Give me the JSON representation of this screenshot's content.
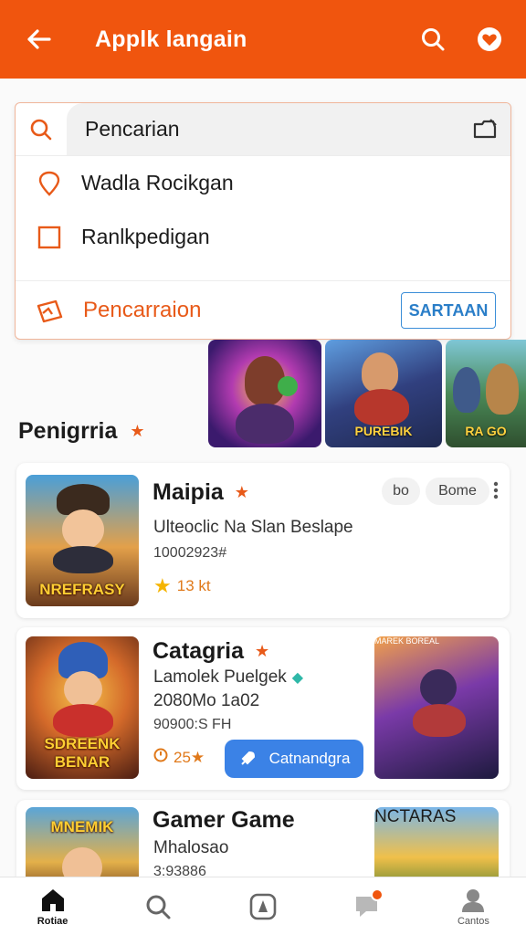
{
  "colors": {
    "accent": "#f0550e",
    "blue": "#3b82e6",
    "star": "#e85a19"
  },
  "header": {
    "title": "Applk langain"
  },
  "search": {
    "placeholder": "Pencarian",
    "options": [
      {
        "label": "Wadla Rocikgan",
        "icon": "location-pin-icon"
      },
      {
        "label": "Ranlkpedigan",
        "icon": "checkbox-icon"
      }
    ],
    "bottom_label": "Pencarraion",
    "bottom_button": "SARTAAN"
  },
  "featured": {
    "title": "Penigrria",
    "items": [
      {
        "label": ""
      },
      {
        "label": "PUREBIK"
      },
      {
        "label": "RA GO"
      }
    ]
  },
  "cards": [
    {
      "title": "Maipia",
      "thumb_text": "NREFRASY",
      "tags": [
        "bo",
        "Bome"
      ],
      "subtitle": "Ulteoclic Na Slan Beslape",
      "meta": "10002923#",
      "rating": "13 kt"
    },
    {
      "title": "Catagria",
      "thumb_text": "SDREENK BENAR",
      "subtitle": "Lamolek Puelgek",
      "meta1": "2080Mo 1a02",
      "meta2": "90900:S FH",
      "rating": "25★",
      "button": "Catnandgra",
      "side_text": "MAREK BOREAL"
    },
    {
      "title": "Gamer Game",
      "thumb_text": "MNEMIK",
      "subtitle": "Mhalosao",
      "meta": "3:93886",
      "side_text": "NCTARAS"
    }
  ],
  "nav": [
    {
      "label": "Rotiae",
      "icon": "home-icon"
    },
    {
      "label": "",
      "icon": "search-icon"
    },
    {
      "label": "",
      "icon": "compass-icon"
    },
    {
      "label": "",
      "icon": "chat-icon"
    },
    {
      "label": "Cantos",
      "icon": "profile-icon"
    }
  ]
}
